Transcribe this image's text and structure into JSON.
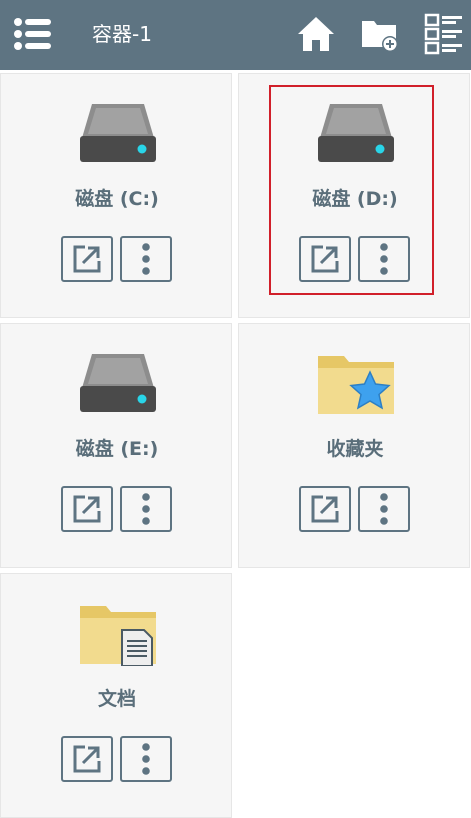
{
  "topbar": {
    "title": "容器-1",
    "icons": [
      "menu-icon",
      "home-icon",
      "new-folder-icon",
      "view-list-icon"
    ]
  },
  "items": [
    {
      "label": "磁盘 (C:)",
      "icon": "drive-icon"
    },
    {
      "label": "磁盘 (D:)",
      "icon": "drive-icon",
      "selected": true
    },
    {
      "label": "磁盘 (E:)",
      "icon": "drive-icon"
    },
    {
      "label": "收藏夹",
      "icon": "favorite-folder-icon"
    },
    {
      "label": "文档",
      "icon": "document-folder-icon"
    }
  ],
  "colors": {
    "topbar": "#5e7482",
    "label": "#5a6e7a",
    "selection": "#d11f2a",
    "led": "#29d5e8",
    "folder": "#f2db8e",
    "star": "#3ea1ee"
  }
}
